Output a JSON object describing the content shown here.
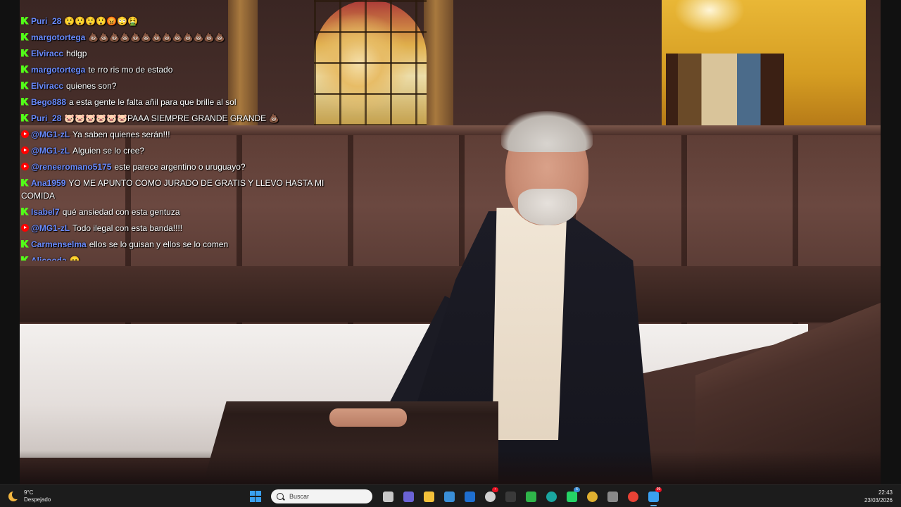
{
  "chat": {
    "messages": [
      {
        "platform": "kick",
        "user": "Puri_28",
        "text": "😲😲😲😲😡😳🤮"
      },
      {
        "platform": "kick",
        "user": "margotortega",
        "text": "💩💩💩💩💩💩💩💩💩💩💩💩💩"
      },
      {
        "platform": "kick",
        "user": "Elviracc",
        "text": "hdlgp"
      },
      {
        "platform": "kick",
        "user": "margotortega",
        "text": "te rro ris mo de estado"
      },
      {
        "platform": "kick",
        "user": "Elviracc",
        "text": "quienes son?"
      },
      {
        "platform": "kick",
        "user": "Bego888",
        "text": "a esta gente le falta añil para que brille al sol"
      },
      {
        "platform": "kick",
        "user": "Puri_28",
        "text": "🐷🐷🐷🐷🐷🐷PAAA SIEMPRE GRANDE GRANDE 💩"
      },
      {
        "platform": "youtube",
        "user": "@MG1-zL",
        "text": "Ya saben quienes serán!!!"
      },
      {
        "platform": "youtube",
        "user": "@MG1-zL",
        "text": "Alguien se lo cree?"
      },
      {
        "platform": "youtube",
        "user": "@reneeromano5175",
        "text": "este parece argentino o uruguayo?"
      },
      {
        "platform": "kick",
        "user": "Ana1959",
        "text": "YO ME APUNTO COMO JURADO DE GRATIS Y LLEVO HASTA MI COMIDA"
      },
      {
        "platform": "kick",
        "user": "Isabel7",
        "text": "qué ansiedad con esta gentuza"
      },
      {
        "platform": "youtube",
        "user": "@MG1-zL",
        "text": "Todo ilegal con esta banda!!!!"
      },
      {
        "platform": "kick",
        "user": "Carmenselma",
        "text": "ellos se lo guisan y ellos se lo comen"
      },
      {
        "platform": "kick",
        "user": "Alicooda",
        "text": "😐"
      }
    ]
  },
  "taskbar": {
    "weather_temp": "9°C",
    "weather_desc": "Despejado",
    "search_placeholder": "Buscar",
    "time": "22:43",
    "date": "23/03/2026",
    "apps": [
      {
        "name": "task-view-icon",
        "color": "#c8c8c8",
        "badge": ""
      },
      {
        "name": "teams-icon",
        "color": "#6b63d6",
        "badge": ""
      },
      {
        "name": "file-explorer-icon",
        "color": "#f3c13a",
        "badge": ""
      },
      {
        "name": "store-icon",
        "color": "#3a8fd8",
        "badge": ""
      },
      {
        "name": "outlook-icon",
        "color": "#1f6fd0",
        "badge": ""
      },
      {
        "name": "record-icon",
        "color": "#d0d0d0",
        "badge": "•"
      },
      {
        "name": "obs-icon",
        "color": "#3a3a3a",
        "badge": ""
      },
      {
        "name": "camtasia-icon",
        "color": "#2fb54a",
        "badge": ""
      },
      {
        "name": "edge-icon",
        "color": "#1aa6a0",
        "badge": ""
      },
      {
        "name": "whatsapp-icon",
        "color": "#25d366",
        "badge": "6"
      },
      {
        "name": "chrome-dev-icon",
        "color": "#e0b030",
        "badge": ""
      },
      {
        "name": "vpn-icon",
        "color": "#8a8a8a",
        "badge": ""
      },
      {
        "name": "chrome-icon",
        "color": "#e94235",
        "badge": ""
      },
      {
        "name": "telegram-icon",
        "color": "#3aa0f0",
        "badge": "99"
      }
    ]
  }
}
